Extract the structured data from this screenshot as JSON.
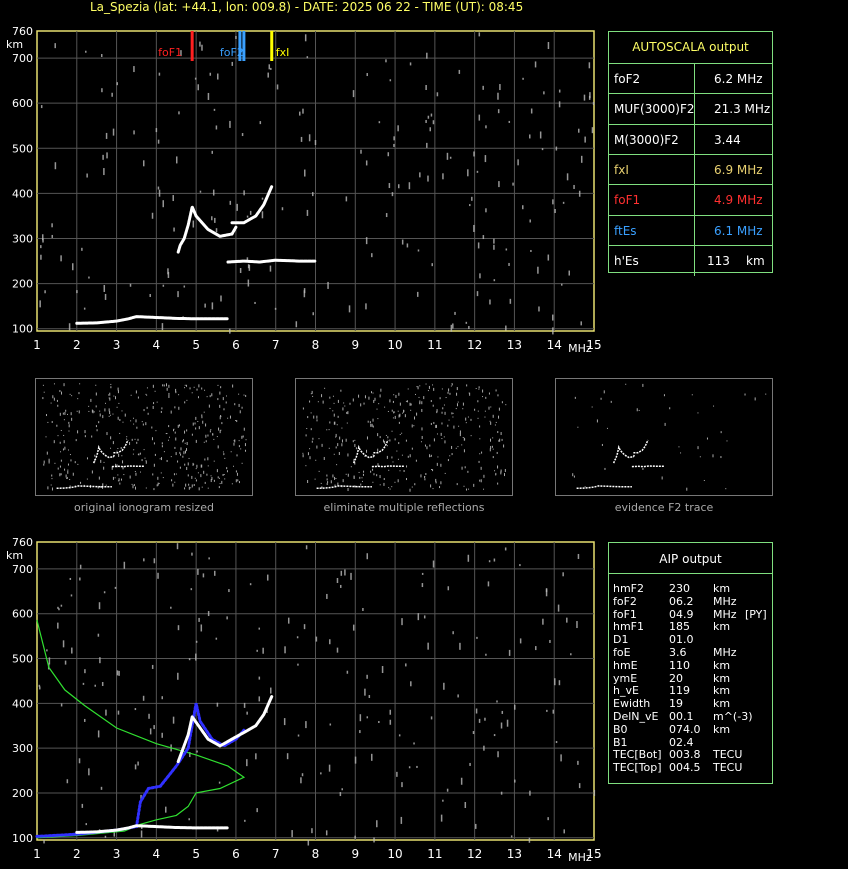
{
  "header": {
    "title": "La_Spezia (lat: +44.1, lon: 009.8) - DATE: 2025 06 22 - TIME (UT): 08:45"
  },
  "axis": {
    "y_unit": "km",
    "x_unit": "MHz",
    "y_ticks": [
      "100",
      "200",
      "300",
      "400",
      "500",
      "600",
      "700",
      "760"
    ],
    "x_ticks": [
      "1",
      "2",
      "3",
      "4",
      "5",
      "6",
      "7",
      "8",
      "9",
      "10",
      "11",
      "12",
      "13",
      "14",
      "15"
    ]
  },
  "markers": {
    "foF1": "foF1",
    "foF2": "foF2",
    "fxI": "fxI",
    "fEs": "f"
  },
  "autoscala": {
    "title": "AUTOSCALA output",
    "rows": [
      {
        "label": "foF2",
        "value": "6.2 MHz",
        "color": "#ffffff"
      },
      {
        "label": "MUF(3000)F2",
        "value": "21.3 MHz",
        "color": "#ffffff"
      },
      {
        "label": "M(3000)F2",
        "value": "3.44",
        "color": "#ffffff"
      },
      {
        "label": "fxI",
        "value": "6.9 MHz",
        "color": "#e8d070"
      },
      {
        "label": "foF1",
        "value": "4.9 MHz",
        "color": "#ff3030"
      },
      {
        "label": "ftEs",
        "value": "6.1 MHz",
        "color": "#3aa0ff"
      },
      {
        "label": "h'Es",
        "value": "113",
        "unit": "km",
        "color": "#ffffff"
      }
    ]
  },
  "thumbnails": [
    {
      "caption": "original ionogram resized"
    },
    {
      "caption": "eliminate multiple reflections"
    },
    {
      "caption": "evidence F2 trace"
    }
  ],
  "aip": {
    "title": "AIP output",
    "rows": [
      {
        "name": "hmF2",
        "value": "230",
        "unit": "km",
        "extra": ""
      },
      {
        "name": "foF2",
        "value": "06.2",
        "unit": "MHz",
        "extra": ""
      },
      {
        "name": "foF1",
        "value": "04.9",
        "unit": "MHz",
        "extra": "[PY]"
      },
      {
        "name": "hmF1",
        "value": "185",
        "unit": "km",
        "extra": ""
      },
      {
        "name": "D1",
        "value": "01.0",
        "unit": "",
        "extra": ""
      },
      {
        "name": "foE",
        "value": "3.6",
        "unit": "MHz",
        "extra": ""
      },
      {
        "name": "hmE",
        "value": "110",
        "unit": "km",
        "extra": ""
      },
      {
        "name": "ymE",
        "value": "20",
        "unit": "km",
        "extra": ""
      },
      {
        "name": "h_vE",
        "value": "119",
        "unit": "km",
        "extra": ""
      },
      {
        "name": "Ewidth",
        "value": "19",
        "unit": "km",
        "extra": ""
      },
      {
        "name": "DelN_vE",
        "value": "00.1",
        "unit": "m^(-3)",
        "extra": ""
      },
      {
        "name": "B0",
        "value": "074.0",
        "unit": "km",
        "extra": ""
      },
      {
        "name": "B1",
        "value": "02.4",
        "unit": "",
        "extra": ""
      },
      {
        "name": "TEC[Bot]",
        "value": "003.8",
        "unit": "TECU",
        "extra": ""
      },
      {
        "name": "TEC[Top]",
        "value": "004.5",
        "unit": "TECU",
        "extra": ""
      }
    ]
  },
  "chart_data": [
    {
      "type": "scatter",
      "title": "",
      "xlabel": "MHz",
      "ylabel": "km",
      "xlim": [
        1,
        15
      ],
      "ylim": [
        95,
        760
      ],
      "grid": true,
      "series": [
        {
          "name": "Es trace",
          "color": "#ffffff",
          "points": [
            [
              2.0,
              112
            ],
            [
              2.5,
              113
            ],
            [
              3.0,
              117
            ],
            [
              3.3,
              122
            ],
            [
              3.5,
              127
            ],
            [
              4.0,
              125
            ],
            [
              4.5,
              123
            ],
            [
              5.0,
              122
            ],
            [
              5.5,
              122
            ],
            [
              5.8,
              122
            ]
          ]
        },
        {
          "name": "F1 trace",
          "color": "#ffffff",
          "points": [
            [
              4.55,
              270
            ],
            [
              4.6,
              285
            ],
            [
              4.7,
              300
            ],
            [
              4.8,
              330
            ],
            [
              4.9,
              370
            ],
            [
              5.0,
              350
            ],
            [
              5.3,
              320
            ],
            [
              5.6,
              305
            ],
            [
              5.9,
              310
            ],
            [
              6.0,
              325
            ]
          ]
        },
        {
          "name": "F2 trace",
          "color": "#ffffff",
          "points": [
            [
              5.9,
              335
            ],
            [
              6.2,
              335
            ],
            [
              6.5,
              350
            ],
            [
              6.7,
              375
            ],
            [
              6.9,
              415
            ]
          ]
        },
        {
          "name": "multiple",
          "color": "#ffffff",
          "points": [
            [
              5.8,
              248
            ],
            [
              6.2,
              250
            ],
            [
              6.6,
              248
            ],
            [
              7.0,
              252
            ],
            [
              7.6,
              250
            ],
            [
              8.0,
              250
            ]
          ]
        }
      ],
      "markers": [
        {
          "label": "foF1",
          "freq": 4.9,
          "color": "#ff2020"
        },
        {
          "label": "foF2",
          "freq": 6.2,
          "color": "#3aa0ff"
        },
        {
          "label": "fxI",
          "freq": 6.9,
          "color": "#ffff00"
        },
        {
          "label": "ftEs",
          "freq": 6.1,
          "color": "#3aa0ff"
        }
      ]
    },
    {
      "type": "line",
      "title": "",
      "xlabel": "MHz",
      "ylabel": "km",
      "xlim": [
        1,
        15
      ],
      "ylim": [
        95,
        760
      ],
      "grid": true,
      "series": [
        {
          "name": "profile",
          "color": "#30e030",
          "points": [
            [
              1.0,
              585
            ],
            [
              1.3,
              480
            ],
            [
              1.7,
              430
            ],
            [
              2.2,
              395
            ],
            [
              3.0,
              345
            ],
            [
              4.0,
              310
            ],
            [
              5.0,
              285
            ],
            [
              5.8,
              260
            ],
            [
              6.2,
              235
            ],
            [
              5.6,
              210
            ],
            [
              5.0,
              200
            ],
            [
              4.8,
              170
            ],
            [
              4.5,
              150
            ],
            [
              4.0,
              140
            ],
            [
              3.6,
              130
            ],
            [
              3.2,
              115
            ],
            [
              2.0,
              105
            ],
            [
              1.0,
              100
            ]
          ]
        },
        {
          "name": "AIP trace",
          "color": "#3030ff",
          "points": [
            [
              1.0,
              103
            ],
            [
              2.0,
              108
            ],
            [
              3.0,
              117
            ],
            [
              3.5,
              125
            ],
            [
              3.6,
              180
            ],
            [
              3.8,
              210
            ],
            [
              4.1,
              215
            ],
            [
              4.5,
              260
            ],
            [
              4.8,
              300
            ],
            [
              5.0,
              400
            ],
            [
              5.1,
              360
            ],
            [
              5.4,
              320
            ],
            [
              5.7,
              305
            ],
            [
              6.0,
              320
            ],
            [
              6.2,
              340
            ]
          ]
        },
        {
          "name": "Es trace",
          "color": "#ffffff",
          "points": [
            [
              2.0,
              112
            ],
            [
              2.5,
              113
            ],
            [
              3.0,
              117
            ],
            [
              3.3,
              122
            ],
            [
              3.5,
              127
            ],
            [
              4.0,
              125
            ],
            [
              4.5,
              123
            ],
            [
              5.0,
              122
            ],
            [
              5.5,
              122
            ],
            [
              5.8,
              122
            ]
          ]
        },
        {
          "name": "F trace",
          "color": "#ffffff",
          "points": [
            [
              4.55,
              270
            ],
            [
              4.8,
              330
            ],
            [
              4.9,
              370
            ],
            [
              5.3,
              320
            ],
            [
              5.6,
              305
            ],
            [
              6.0,
              325
            ],
            [
              6.2,
              335
            ],
            [
              6.5,
              350
            ],
            [
              6.7,
              375
            ],
            [
              6.9,
              415
            ]
          ]
        }
      ]
    }
  ]
}
